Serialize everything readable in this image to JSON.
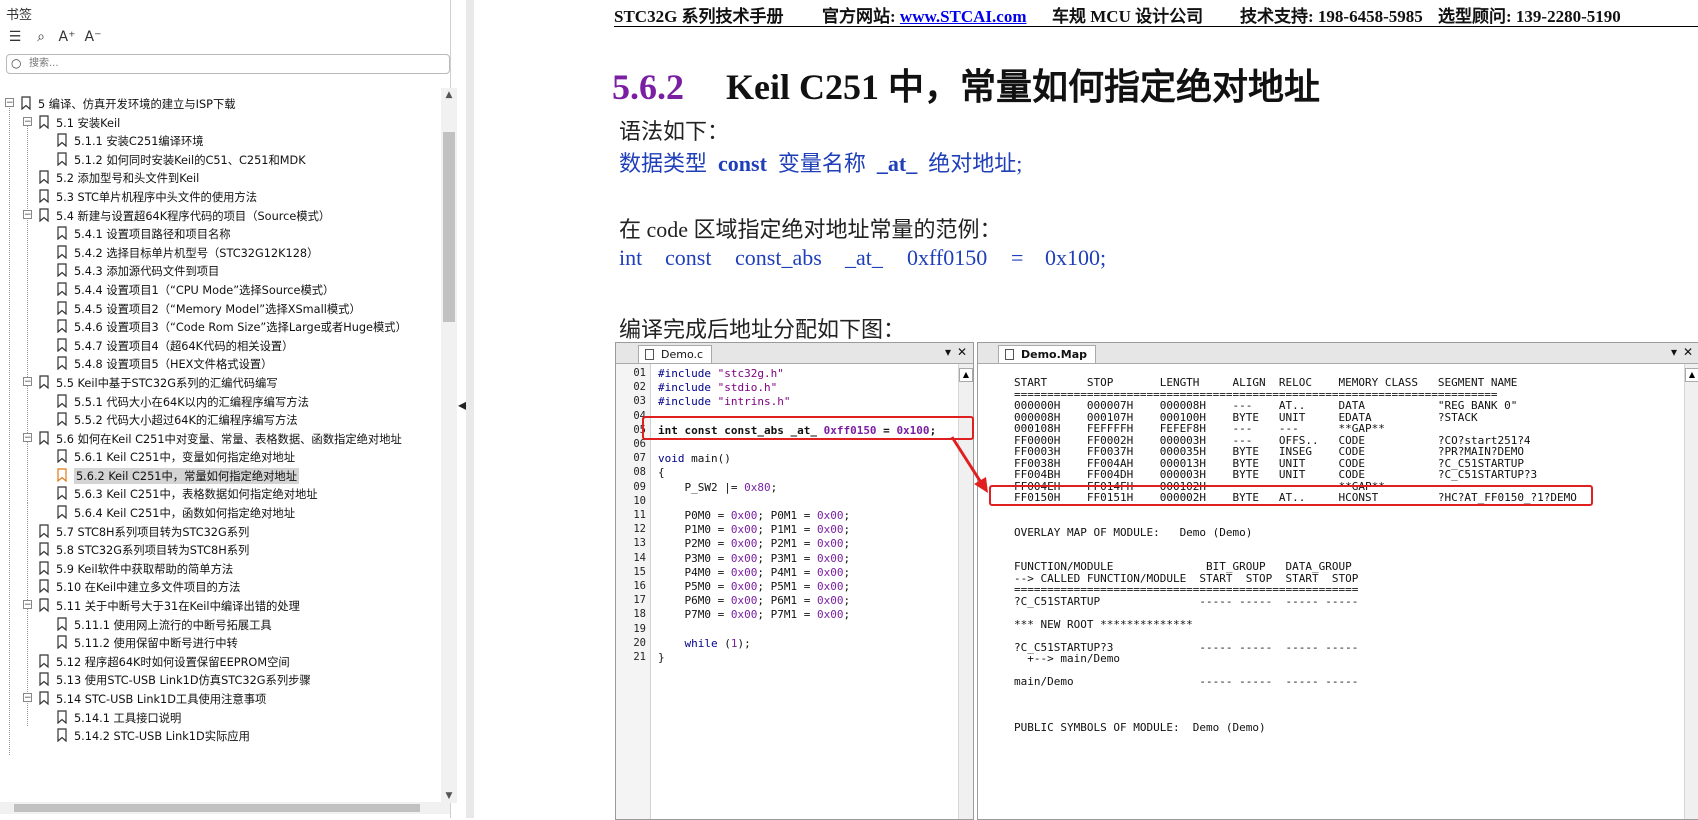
{
  "sidebar": {
    "title": "书签",
    "search_placeholder": "搜索...",
    "items": [
      {
        "label": "5  编译、仿真开发环境的建立与ISP下载",
        "level": 0,
        "expander": "−"
      },
      {
        "label": "5.1 安装Keil",
        "level": 1,
        "expander": "−"
      },
      {
        "label": "5.1.1 安装C251编译环境",
        "level": 2,
        "expander": ""
      },
      {
        "label": "5.1.2  如何同时安装Keil的C51、C251和MDK",
        "level": 2,
        "expander": ""
      },
      {
        "label": "5.2  添加型号和头文件到Keil",
        "level": 1,
        "expander": ""
      },
      {
        "label": "5.3  STC单片机程序中头文件的使用方法",
        "level": 1,
        "expander": ""
      },
      {
        "label": "5.4  新建与设置超64K程序代码的项目（Source模式）",
        "level": 1,
        "expander": "−"
      },
      {
        "label": "5.4.1 设置项目路径和项目名称",
        "level": 2,
        "expander": ""
      },
      {
        "label": "5.4.2 选择目标单片机型号（STC32G12K128）",
        "level": 2,
        "expander": ""
      },
      {
        "label": "5.4.3 添加源代码文件到项目",
        "level": 2,
        "expander": ""
      },
      {
        "label": "5.4.4 设置项目1（“CPU Mode”选择Source模式）",
        "level": 2,
        "expander": ""
      },
      {
        "label": "5.4.5 设置项目2（“Memory Model”选择XSmall模式）",
        "level": 2,
        "expander": ""
      },
      {
        "label": "5.4.6  设置项目3（“Code Rom Size”选择Large或者Huge模式）",
        "level": 2,
        "expander": ""
      },
      {
        "label": "5.4.7  设置项目4（超64K代码的相关设置）",
        "level": 2,
        "expander": ""
      },
      {
        "label": "5.4.8  设置项目5（HEX文件格式设置）",
        "level": 2,
        "expander": ""
      },
      {
        "label": "5.5  Keil中基于STC32G系列的汇编代码编写",
        "level": 1,
        "expander": "−"
      },
      {
        "label": "5.5.1 代码大小在64K以内的汇编程序编写方法",
        "level": 2,
        "expander": ""
      },
      {
        "label": "5.5.2 代码大小超过64K的汇编程序编写方法",
        "level": 2,
        "expander": ""
      },
      {
        "label": "5.6  如何在Keil C251中对变量、常量、表格数据、函数指定绝对地址",
        "level": 1,
        "expander": "−"
      },
      {
        "label": "5.6.1 Keil C251中，变量如何指定绝对地址",
        "level": 2,
        "expander": ""
      },
      {
        "label": "5.6.2  Keil C251中，常量如何指定绝对地址",
        "level": 2,
        "expander": "",
        "active": true
      },
      {
        "label": "5.6.3  Keil C251中，表格数据如何指定绝对地址",
        "level": 2,
        "expander": ""
      },
      {
        "label": "5.6.4  Keil C251中，函数如何指定绝对地址",
        "level": 2,
        "expander": ""
      },
      {
        "label": "5.7  STC8H系列项目转为STC32G系列",
        "level": 1,
        "expander": ""
      },
      {
        "label": "5.8  STC32G系列项目转为STC8H系列",
        "level": 1,
        "expander": ""
      },
      {
        "label": "5.9  Keil软件中获取帮助的简单方法",
        "level": 1,
        "expander": ""
      },
      {
        "label": "5.10  在Keil中建立多文件项目的方法",
        "level": 1,
        "expander": ""
      },
      {
        "label": "5.11  关于中断号大于31在Keil中编译出错的处理",
        "level": 1,
        "expander": "−"
      },
      {
        "label": "5.11.1 使用网上流行的中断号拓展工具",
        "level": 2,
        "expander": ""
      },
      {
        "label": "5.11.2  使用保留中断号进行中转",
        "level": 2,
        "expander": ""
      },
      {
        "label": "5.12  程序超64K时如何设置保留EEPROM空间",
        "level": 1,
        "expander": ""
      },
      {
        "label": "5.13  使用STC-USB Link1D仿真STC32G系列步骤",
        "level": 1,
        "expander": ""
      },
      {
        "label": "5.14  STC-USB Link1D工具使用注意事项",
        "level": 1,
        "expander": "−"
      },
      {
        "label": "5.14.1 工具接口说明",
        "level": 2,
        "expander": ""
      },
      {
        "label": "5.14.2  STC-USB Link1D实际应用",
        "level": 2,
        "expander": ""
      }
    ]
  },
  "header": {
    "manual": "STC32G 系列技术手册",
    "site_label": "官方网站: ",
    "site_url": "www.STCAI.com",
    "company": "车规 MCU 设计公司",
    "support": "技术支持: 198-6458-5985",
    "consultant": "选型顾问: 139-2280-5190"
  },
  "section": {
    "number": "5.6.2",
    "title": "Keil C251 中，常量如何指定绝对地址"
  },
  "body": {
    "syntax_intro": "语法如下：",
    "syntax": {
      "t1": "数据类型",
      "t2": "const",
      "t3": "变量名称",
      "t4": "_at_",
      "t5": "绝对地址;"
    },
    "example_intro": "在 code 区域指定绝对地址常量的范例：",
    "example": {
      "t1": "int",
      "t2": "const",
      "t3": "const_abs",
      "t4": "_at_",
      "t5": "0xff0150",
      "t6": "=",
      "t7": "0x100;"
    },
    "result_intro": "编译完成后地址分配如下图："
  },
  "code_window": {
    "tab": "Demo.c",
    "line_numbers": [
      "01",
      "02",
      "03",
      "04",
      "05",
      "06",
      "07",
      "08",
      "09",
      "10",
      "11",
      "12",
      "13",
      "14",
      "15",
      "16",
      "17",
      "18",
      "19",
      "20",
      "21"
    ]
  },
  "map_window": {
    "tab": "Demo.Map",
    "lines": [
      "START      STOP       LENGTH     ALIGN  RELOC    MEMORY CLASS   SEGMENT NAME",
      "=========================================================================",
      "000000H    000007H    000008H    ---    AT..     DATA           \"REG BANK 0\"",
      "000008H    000107H    000100H    BYTE   UNIT     EDATA          ?STACK",
      "000108H    FEFFFFH    FEFEF8H    ---    ---      **GAP**",
      "FF0000H    FF0002H    000003H    ---    OFFS..   CODE           ?CO?start251?4",
      "FF0003H    FF0037H    000035H    BYTE   INSEG    CODE           ?PR?MAIN?DEMO",
      "FF0038H    FF004AH    000013H    BYTE   UNIT     CODE           ?C_C51STARTUP",
      "FF004BH    FF004DH    000003H    BYTE   UNIT     CODE           ?C_C51STARTUP?3",
      "FF004EH    FF014FH    000102H                    **GAP**",
      "FF0150H    FF0151H    000002H    BYTE   AT..     HCONST         ?HC?AT_FF0150_?1?DEMO",
      "",
      "",
      "OVERLAY MAP OF MODULE:   Demo (Demo)",
      "",
      "",
      "FUNCTION/MODULE              BIT_GROUP   DATA_GROUP",
      "--> CALLED FUNCTION/MODULE  START  STOP  START  STOP",
      "====================================================",
      "?C_C51STARTUP               ----- -----  ----- -----",
      "",
      "*** NEW ROOT **************",
      "",
      "?C_C51STARTUP?3             ----- -----  ----- -----",
      "  +--> main/Demo",
      "",
      "main/Demo                   ----- -----  ----- -----",
      "",
      "",
      "",
      "PUBLIC SYMBOLS OF MODULE:  Demo (Demo)"
    ]
  }
}
